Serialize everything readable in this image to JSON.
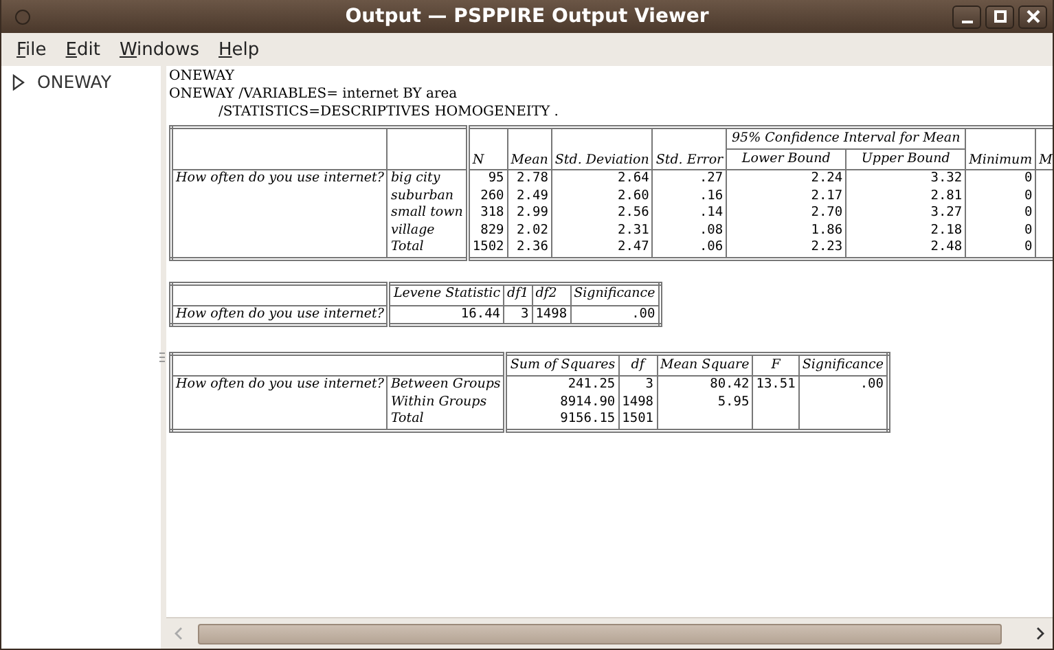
{
  "window": {
    "title": "Output — PSPPIRE Output Viewer"
  },
  "menu": [
    "File",
    "Edit",
    "Windows",
    "Help"
  ],
  "outline": [
    {
      "label": "ONEWAY",
      "expanded": false
    }
  ],
  "syntax": [
    {
      "text": "ONEWAY",
      "indented": false
    },
    {
      "text": "ONEWAY /VARIABLES= internet BY area",
      "indented": false
    },
    {
      "text": "/STATISTICS=DESCRIPTIVES HOMOGENEITY .",
      "indented": true
    }
  ],
  "descriptives": {
    "columns": [
      "N",
      "Mean",
      "Std. Deviation",
      "Std. Error",
      "Lower Bound",
      "Upper Bound",
      "Minimum",
      "M"
    ],
    "span_header": "95% Confidence Interval for Mean",
    "variable": "How often do you use internet?",
    "rows": [
      {
        "group": "big city",
        "values": [
          "95",
          "2.78",
          "2.64",
          ".27",
          "2.24",
          "3.32",
          "0"
        ]
      },
      {
        "group": "suburban",
        "values": [
          "260",
          "2.49",
          "2.60",
          ".16",
          "2.17",
          "2.81",
          "0"
        ]
      },
      {
        "group": "small town",
        "values": [
          "318",
          "2.99",
          "2.56",
          ".14",
          "2.70",
          "3.27",
          "0"
        ]
      },
      {
        "group": "village",
        "values": [
          "829",
          "2.02",
          "2.31",
          ".08",
          "1.86",
          "2.18",
          "0"
        ]
      },
      {
        "group": "Total",
        "values": [
          "1502",
          "2.36",
          "2.47",
          ".06",
          "2.23",
          "2.48",
          "0"
        ]
      }
    ]
  },
  "homogeneity": {
    "columns": [
      "Levene Statistic",
      "df1",
      "df2",
      "Significance"
    ],
    "variable": "How often do you use internet?",
    "values": [
      "16.44",
      "3",
      "1498",
      ".00"
    ]
  },
  "anova": {
    "columns": [
      "Sum of Squares",
      "df",
      "Mean Square",
      "F",
      "Significance"
    ],
    "variable": "How often do you use internet?",
    "rows": [
      {
        "group": "Between Groups",
        "values": [
          "241.25",
          "3",
          "80.42",
          "13.51",
          ".00"
        ]
      },
      {
        "group": "Within Groups",
        "values": [
          "8914.90",
          "1498",
          "5.95"
        ]
      },
      {
        "group": "Total",
        "values": [
          "9156.15",
          "1501"
        ]
      }
    ]
  }
}
